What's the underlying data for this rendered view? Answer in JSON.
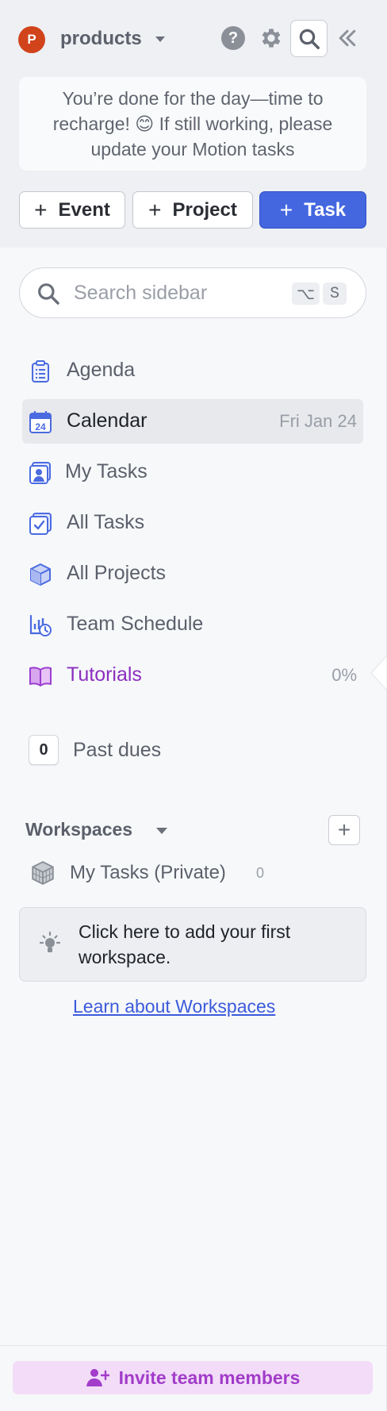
{
  "header": {
    "avatar_initial": "P",
    "workspace_name": "products",
    "help_glyph": "?",
    "icons": [
      "help-icon",
      "gear-icon",
      "search-icon",
      "collapse-icon"
    ]
  },
  "notice": {
    "text": "You’re done for the day—time to recharge! 😊 If still working, please update your Motion tasks"
  },
  "create_buttons": {
    "event": "Event",
    "project": "Project",
    "task": "Task",
    "plus": "+"
  },
  "search": {
    "placeholder": "Search sidebar",
    "value": "",
    "shortcut_keys": [
      "⌥",
      "S"
    ]
  },
  "nav": {
    "agenda": "Agenda",
    "calendar": "Calendar",
    "calendar_meta": "Fri Jan 24",
    "calendar_day": "24",
    "my_tasks": "My Tasks",
    "all_tasks": "All Tasks",
    "all_projects": "All Projects",
    "team_schedule": "Team Schedule",
    "tutorials": "Tutorials",
    "tutorials_progress": "0%"
  },
  "past_dues": {
    "count": "0",
    "label": "Past dues"
  },
  "workspaces": {
    "header": "Workspaces",
    "add_glyph": "+",
    "items": [
      {
        "label": "My Tasks (Private)",
        "count": "0"
      }
    ],
    "hint": "Click here to add your first workspace.",
    "learn_link": "Learn about Workspaces"
  },
  "footer": {
    "invite_label": "Invite team members"
  },
  "colors": {
    "primary": "#4467e0",
    "avatar": "#d1431b",
    "tutorials": "#8b2fc0",
    "invite_bg": "#f2dcf8",
    "invite_text": "#a23cc9"
  }
}
